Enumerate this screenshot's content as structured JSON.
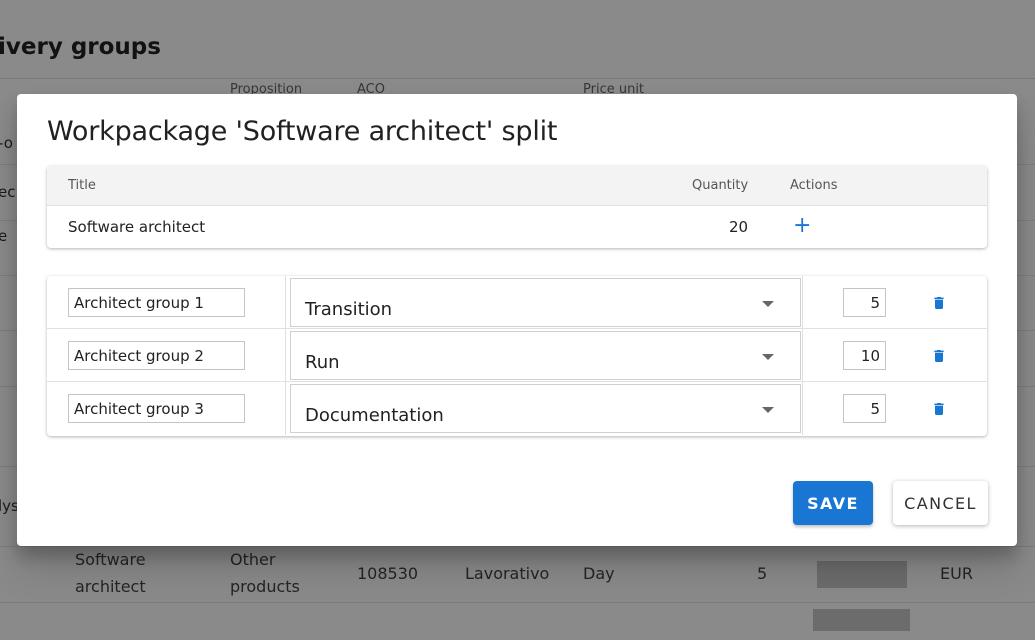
{
  "background": {
    "page_title": "ivery groups",
    "columns": [
      "Proposition",
      "ACO",
      "Price unit"
    ],
    "left_fragments": [
      "-o",
      "ec",
      "e",
      "lys"
    ],
    "row": {
      "title_line1": "Software",
      "title_line2": "architect",
      "proposition_line1": "Other",
      "proposition_line2": "products",
      "aco": "108530",
      "type": "Lavorativo",
      "price_unit": "Day",
      "quantity": "5",
      "currency": "EUR"
    }
  },
  "dialog": {
    "title": "Workpackage 'Software architect' split",
    "summary": {
      "headers": {
        "title": "Title",
        "quantity": "Quantity",
        "actions": "Actions"
      },
      "row": {
        "title": "Software architect",
        "quantity": "20",
        "add_icon": "plus-icon",
        "add_label": "+"
      }
    },
    "groups": [
      {
        "name": "Architect group 1",
        "phase": "Transition",
        "quantity": "5"
      },
      {
        "name": "Architect group 2",
        "phase": "Run",
        "quantity": "10"
      },
      {
        "name": "Architect group 3",
        "phase": "Documentation",
        "quantity": "5"
      }
    ],
    "buttons": {
      "save": "SAVE",
      "cancel": "CANCEL"
    }
  },
  "colors": {
    "primary": "#1976d2",
    "overlay": "rgba(0,0,0,0.46)"
  }
}
